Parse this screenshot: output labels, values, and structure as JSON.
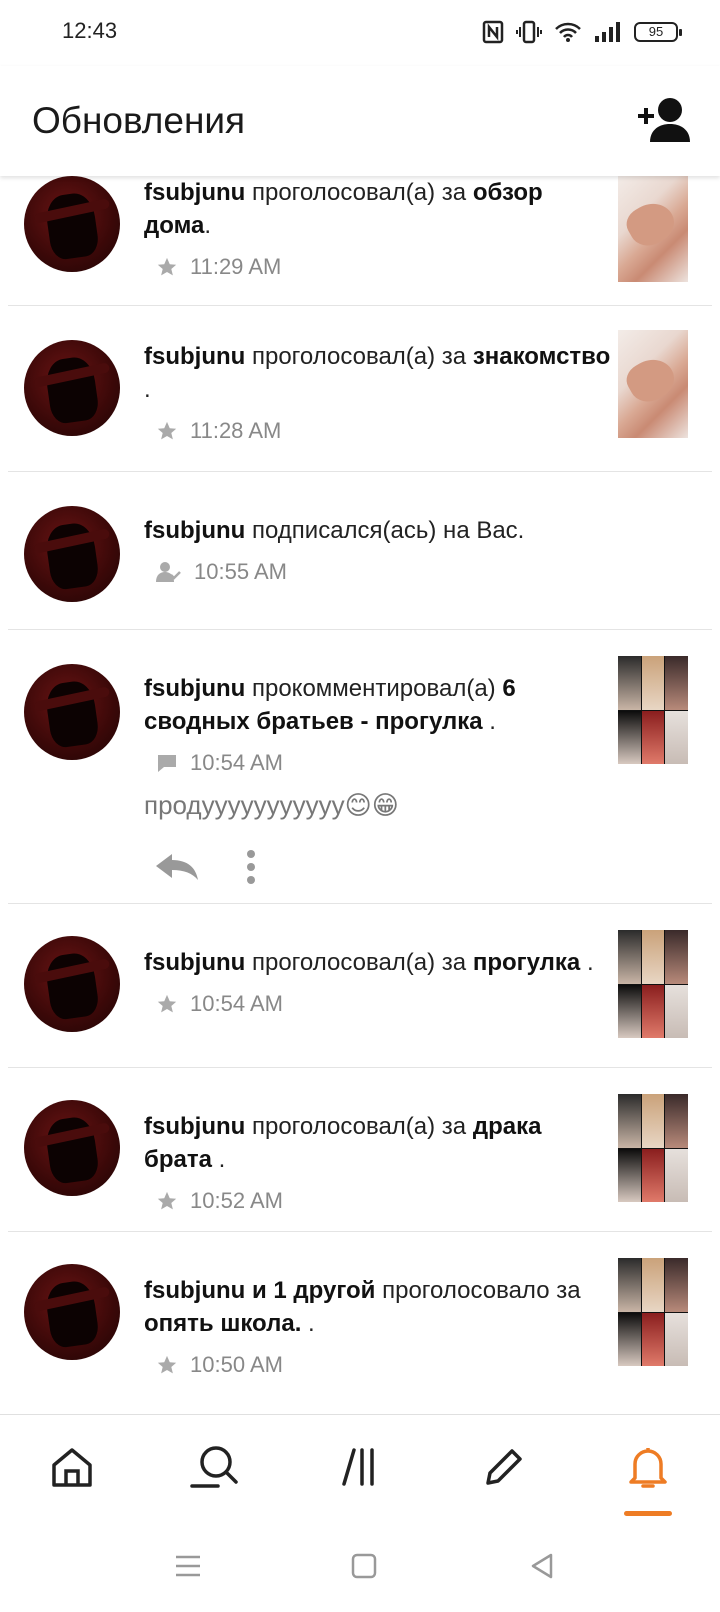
{
  "status_bar": {
    "time": "12:43",
    "battery": "95"
  },
  "header": {
    "title": "Обновления"
  },
  "feed": [
    {
      "user": "fsubjunu",
      "action": "проголосовал(а) за",
      "target": "обзор дома",
      "suffix": ".",
      "time": "11:29 AM",
      "icon": "star-icon",
      "thumbnail": "hands"
    },
    {
      "user": "fsubjunu",
      "action": "проголосовал(а) за",
      "target": "знакомство",
      "suffix": " .",
      "time": "11:28 AM",
      "icon": "star-icon",
      "thumbnail": "hands"
    },
    {
      "user": "fsubjunu",
      "action": "подписался(ась) на Вас.",
      "time": "10:55 AM",
      "icon": "follow-icon"
    },
    {
      "user": "fsubjunu",
      "action": "прокомментировал(а)",
      "target": "6 сводных братьев - прогулка",
      "suffix": " .",
      "time": "10:54 AM",
      "icon": "comment-icon",
      "thumbnail": "collage",
      "comment": "продууууууууууу😊😁"
    },
    {
      "user": "fsubjunu",
      "action": "проголосовал(а) за",
      "target": "прогулка",
      "suffix": " .",
      "time": "10:54 AM",
      "icon": "star-icon",
      "thumbnail": "collage"
    },
    {
      "user": "fsubjunu",
      "action": "проголосовал(а) за",
      "target": "драка брата",
      "suffix": " .",
      "time": "10:52 AM",
      "icon": "star-icon",
      "thumbnail": "collage"
    },
    {
      "user": "fsubjunu и 1 другой",
      "action": "проголосовало за",
      "target": "опять школа.",
      "suffix": " .",
      "time": "10:50 AM",
      "icon": "star-icon",
      "thumbnail": "collage"
    }
  ],
  "bottom_nav": {
    "items": [
      "home-icon",
      "search-icon",
      "library-icon",
      "write-icon",
      "notifications-icon"
    ],
    "active": "notifications-icon",
    "accent_color": "#ee7c24"
  },
  "colors": {
    "accent": "#ee7c24",
    "meta_text": "#888888",
    "divider": "#e4e4e4"
  }
}
